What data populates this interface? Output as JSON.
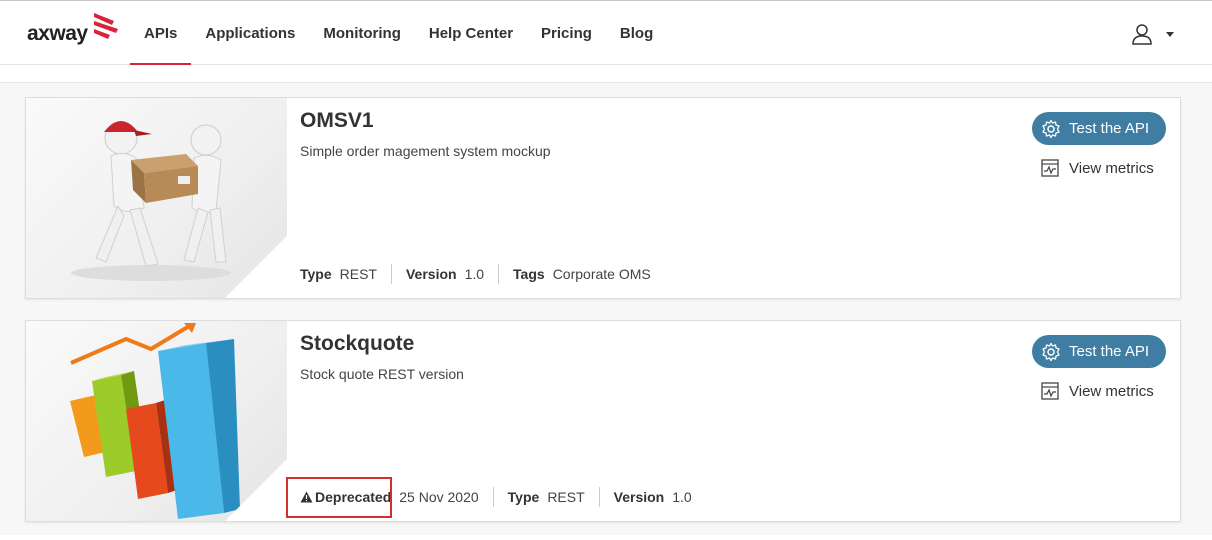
{
  "brand": {
    "logo_text": "axway",
    "accent": "#d6243b",
    "button_color": "#3f7da3"
  },
  "nav": [
    {
      "label": "APIs",
      "active": true
    },
    {
      "label": "Applications",
      "active": false
    },
    {
      "label": "Monitoring",
      "active": false
    },
    {
      "label": "Help Center",
      "active": false
    },
    {
      "label": "Pricing",
      "active": false
    },
    {
      "label": "Blog",
      "active": false
    }
  ],
  "user_menu": {
    "icon": "user-icon"
  },
  "cards": [
    {
      "title": "OMSV1",
      "description": "Simple order magement system mockup",
      "image": "delivery-figures-with-box",
      "meta": [
        {
          "key": "Type",
          "value": "REST"
        },
        {
          "key": "Version",
          "value": "1.0"
        },
        {
          "key": "Tags",
          "value": "Corporate OMS"
        }
      ],
      "test_label": "Test the API",
      "metrics_label": "View metrics"
    },
    {
      "title": "Stockquote",
      "description": "Stock quote REST version",
      "image": "3d-bar-chart-growth",
      "deprecated": {
        "label": "Deprecated",
        "date": "25 Nov 2020",
        "icon": "warning-icon"
      },
      "meta": [
        {
          "key": "Type",
          "value": "REST"
        },
        {
          "key": "Version",
          "value": "1.0"
        }
      ],
      "test_label": "Test the API",
      "metrics_label": "View metrics"
    }
  ]
}
